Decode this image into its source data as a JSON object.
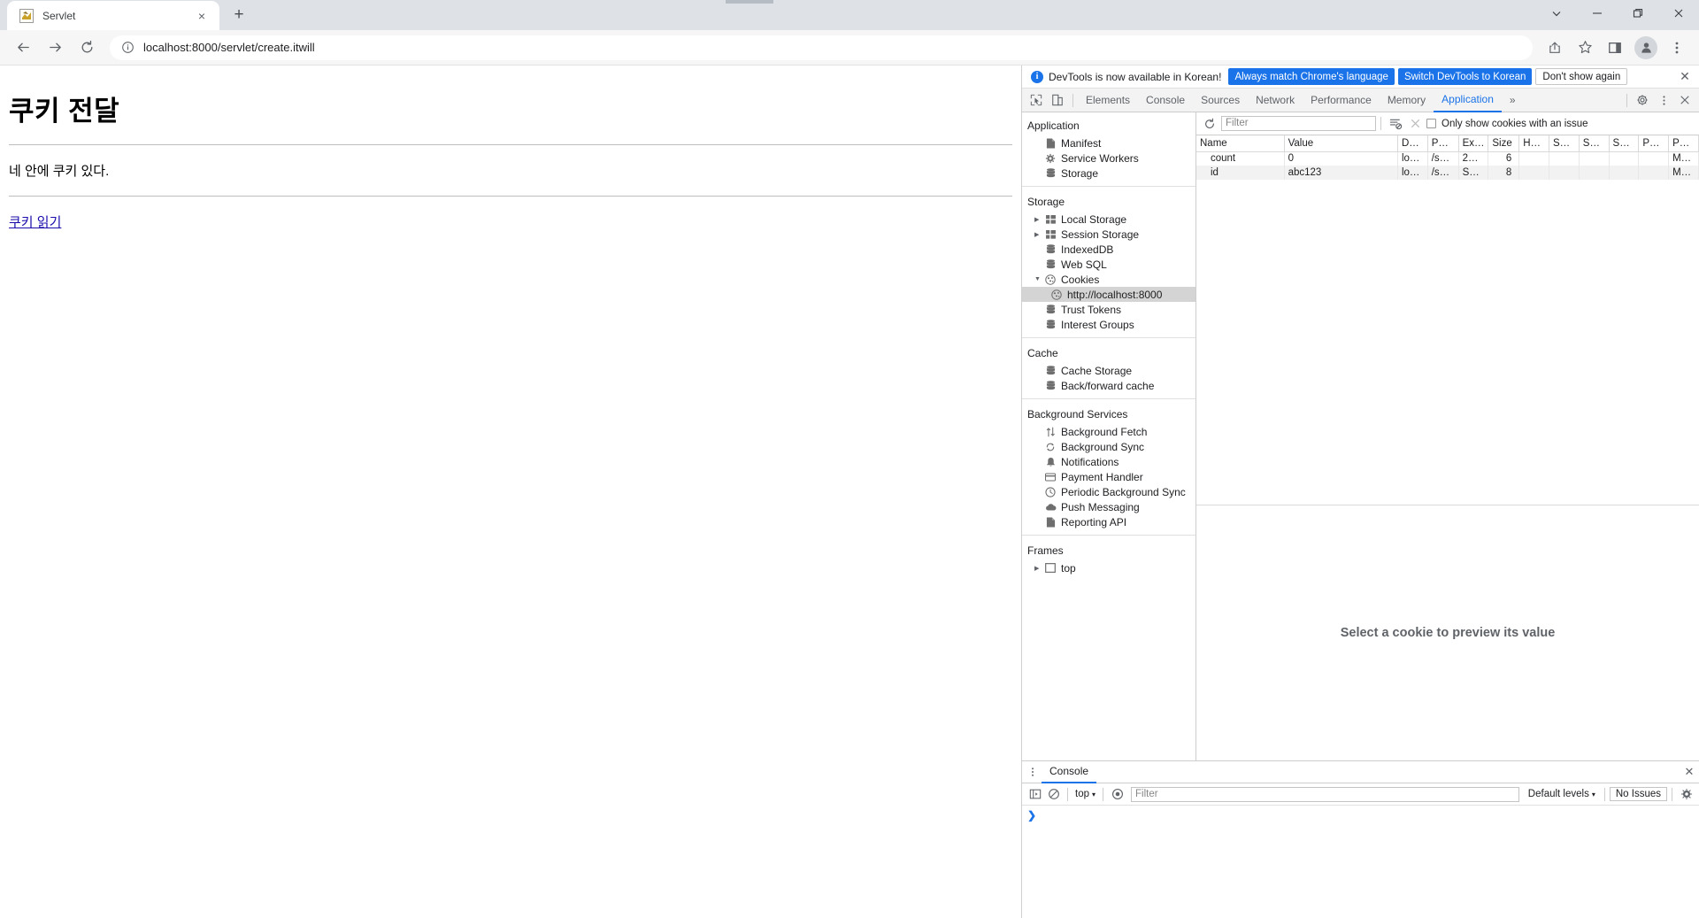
{
  "browser": {
    "tab": {
      "title": "Servlet",
      "favicon": "servlet-favicon",
      "close_label": "×"
    },
    "new_tab_label": "+",
    "window_controls": {
      "minimize": "–",
      "maximize": "❐",
      "close": "✕",
      "expand": "⌄"
    },
    "nav": {
      "back": "←",
      "forward": "→",
      "reload": "⟳"
    },
    "omnibox": {
      "info_icon": "info-circle-icon",
      "url": "localhost:8000/servlet/create.itwill"
    },
    "toolbar_icons": {
      "share": "share-icon",
      "bookmark": "star-icon",
      "sidepanel": "side-panel-icon",
      "profile": "profile-avatar-icon",
      "menu": "three-dot-menu-icon"
    }
  },
  "page": {
    "heading": "쿠키 전달",
    "paragraph": "네 안에 쿠키 있다.",
    "link": "쿠키 읽기"
  },
  "devtools": {
    "banner": {
      "text": "DevTools is now available in Korean!",
      "primary_btn": "Always match Chrome's language",
      "secondary_btn": "Switch DevTools to Korean",
      "dismiss_btn": "Don't show again",
      "close": "✕"
    },
    "tabs": [
      {
        "label": "Elements",
        "active": false
      },
      {
        "label": "Console",
        "active": false
      },
      {
        "label": "Sources",
        "active": false
      },
      {
        "label": "Network",
        "active": false
      },
      {
        "label": "Performance",
        "active": false
      },
      {
        "label": "Memory",
        "active": false
      },
      {
        "label": "Application",
        "active": true
      }
    ],
    "tabs_overflow": "»",
    "right_icons": {
      "settings": "gear-icon",
      "more": "three-dot-menu-icon",
      "close": "close-icon"
    },
    "sidebar": {
      "groups": [
        {
          "header": "Application",
          "items": [
            {
              "label": "Manifest",
              "icon": "document-icon",
              "arrow": false,
              "selected": false
            },
            {
              "label": "Service Workers",
              "icon": "gear-icon",
              "arrow": false,
              "selected": false
            },
            {
              "label": "Storage",
              "icon": "database-icon",
              "arrow": false,
              "selected": false
            }
          ]
        },
        {
          "header": "Storage",
          "items": [
            {
              "label": "Local Storage",
              "icon": "table-icon",
              "arrow": true,
              "selected": false
            },
            {
              "label": "Session Storage",
              "icon": "table-icon",
              "arrow": true,
              "selected": false
            },
            {
              "label": "IndexedDB",
              "icon": "database-icon",
              "arrow": false,
              "selected": false
            },
            {
              "label": "Web SQL",
              "icon": "database-icon",
              "arrow": false,
              "selected": false
            },
            {
              "label": "Cookies",
              "icon": "cookie-icon",
              "arrow": true,
              "expanded": true,
              "selected": false
            },
            {
              "label": "http://localhost:8000",
              "icon": "cookie-icon",
              "arrow": false,
              "selected": true,
              "deep": true
            },
            {
              "label": "Trust Tokens",
              "icon": "database-icon",
              "arrow": false,
              "selected": false
            },
            {
              "label": "Interest Groups",
              "icon": "database-icon",
              "arrow": false,
              "selected": false
            }
          ]
        },
        {
          "header": "Cache",
          "items": [
            {
              "label": "Cache Storage",
              "icon": "database-icon",
              "arrow": false,
              "selected": false
            },
            {
              "label": "Back/forward cache",
              "icon": "database-icon",
              "arrow": false,
              "selected": false
            }
          ]
        },
        {
          "header": "Background Services",
          "items": [
            {
              "label": "Background Fetch",
              "icon": "updown-arrows-icon",
              "arrow": false,
              "selected": false
            },
            {
              "label": "Background Sync",
              "icon": "sync-icon",
              "arrow": false,
              "selected": false
            },
            {
              "label": "Notifications",
              "icon": "bell-icon",
              "arrow": false,
              "selected": false
            },
            {
              "label": "Payment Handler",
              "icon": "credit-card-icon",
              "arrow": false,
              "selected": false
            },
            {
              "label": "Periodic Background Sync",
              "icon": "clock-icon",
              "arrow": false,
              "selected": false
            },
            {
              "label": "Push Messaging",
              "icon": "cloud-icon",
              "arrow": false,
              "selected": false
            },
            {
              "label": "Reporting API",
              "icon": "document-icon",
              "arrow": false,
              "selected": false
            }
          ]
        },
        {
          "header": "Frames",
          "items": [
            {
              "label": "top",
              "icon": "frame-icon",
              "arrow": true,
              "selected": false
            }
          ]
        }
      ]
    },
    "cookies_toolbar": {
      "refresh_icon": "refresh-icon",
      "filter_placeholder": "Filter",
      "clear_all_icon": "clear-all-cookies-icon",
      "delete_icon": "delete-cookie-icon",
      "checkbox_label": "Only show cookies with an issue",
      "checkbox_checked": false
    },
    "cookies_table": {
      "columns": [
        "Name",
        "Value",
        "D…",
        "P…",
        "Ex…",
        "Size",
        "H…",
        "S…",
        "S…",
        "S…",
        "P…",
        "P…"
      ],
      "rows": [
        {
          "name": "count",
          "value": "0",
          "domain": "lo…",
          "path": "/s…",
          "expires": "2…",
          "size": "6",
          "httponly": "",
          "secure": "",
          "samesite": "",
          "samepartykey": "",
          "priority": "",
          "partitionkey": "M…"
        },
        {
          "name": "id",
          "value": "abc123",
          "domain": "lo…",
          "path": "/s…",
          "expires": "S…",
          "size": "8",
          "httponly": "",
          "secure": "",
          "samesite": "",
          "samepartykey": "",
          "priority": "",
          "partitionkey": "M…"
        }
      ]
    },
    "preview_message": "Select a cookie to preview its value",
    "drawer": {
      "more_icon": "three-dot-menu-icon",
      "tab_label": "Console",
      "close": "✕",
      "console_toolbar": {
        "sidebar_icon": "console-sidebar-icon",
        "clear_icon": "clear-console-icon",
        "context": "top",
        "context_caret": "▾",
        "eye_icon": "live-expression-icon",
        "filter_placeholder": "Filter",
        "levels": "Default levels",
        "levels_caret": "▾",
        "issues": "No Issues",
        "settings_icon": "gear-icon"
      },
      "prompt": "❯"
    }
  }
}
